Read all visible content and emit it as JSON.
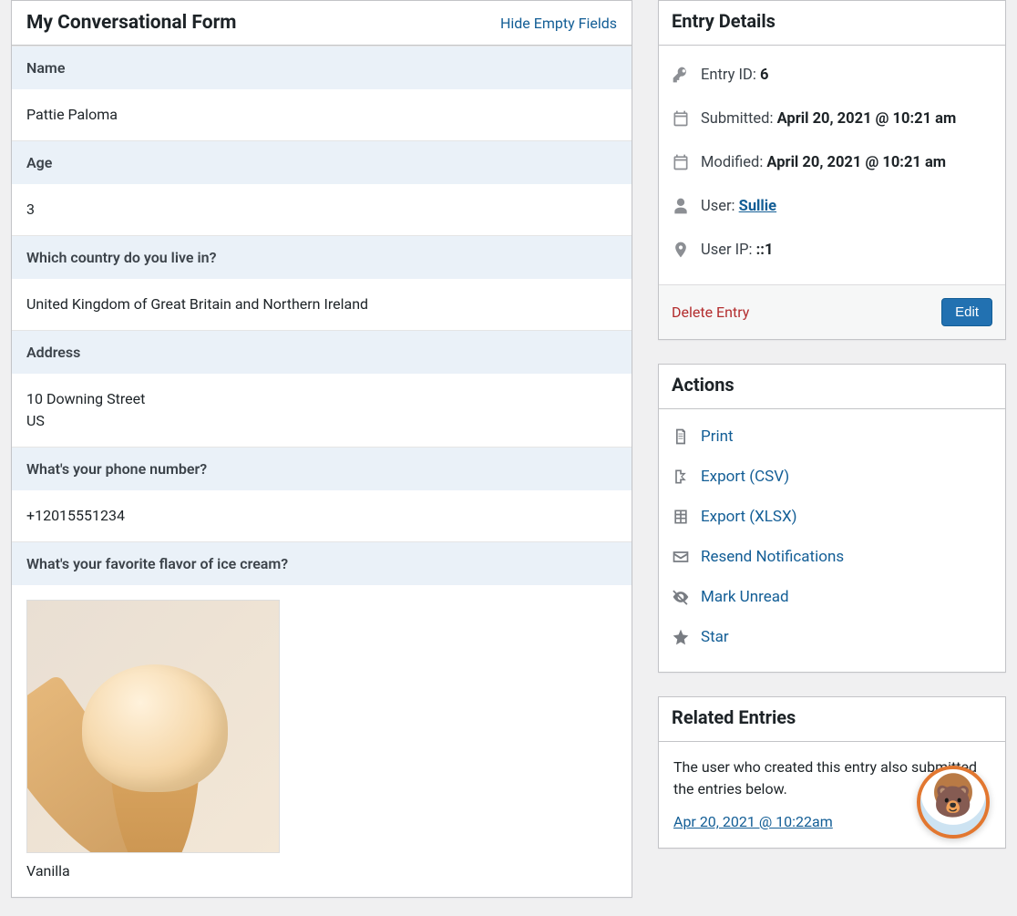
{
  "form": {
    "title": "My Conversational Form",
    "hide_link": "Hide Empty Fields",
    "fields": [
      {
        "label": "Name",
        "value": "Pattie Paloma"
      },
      {
        "label": "Age",
        "value": "3"
      },
      {
        "label": "Which country do you live in?",
        "value": "United Kingdom of Great Britain and Northern Ireland"
      },
      {
        "label": "Address",
        "lines": [
          "10 Downing Street",
          "US"
        ]
      },
      {
        "label": "What's your phone number?",
        "value": "+12015551234"
      },
      {
        "label": "What's your favorite flavor of ice cream?",
        "image_alt": "Ice cream cone",
        "value": "Vanilla"
      }
    ]
  },
  "entry_details": {
    "title": "Entry Details",
    "id_label": "Entry ID: ",
    "id_value": "6",
    "submitted_label": "Submitted: ",
    "submitted_value": "April 20, 2021 @ 10:21 am",
    "modified_label": "Modified: ",
    "modified_value": "April 20, 2021 @ 10:21 am",
    "user_label": "User: ",
    "user_value": "Sullie",
    "ip_label": "User IP: ",
    "ip_value": "::1",
    "delete_label": "Delete Entry",
    "edit_label": "Edit"
  },
  "actions": {
    "title": "Actions",
    "items": {
      "print": "Print",
      "export_csv": "Export (CSV)",
      "export_xlsx": "Export (XLSX)",
      "resend": "Resend Notifications",
      "mark_unread": "Mark Unread",
      "star": "Star"
    }
  },
  "related": {
    "title": "Related Entries",
    "text": "The user who created this entry also submitted the entries below.",
    "link": "Apr 20, 2021 @ 10:22am"
  }
}
